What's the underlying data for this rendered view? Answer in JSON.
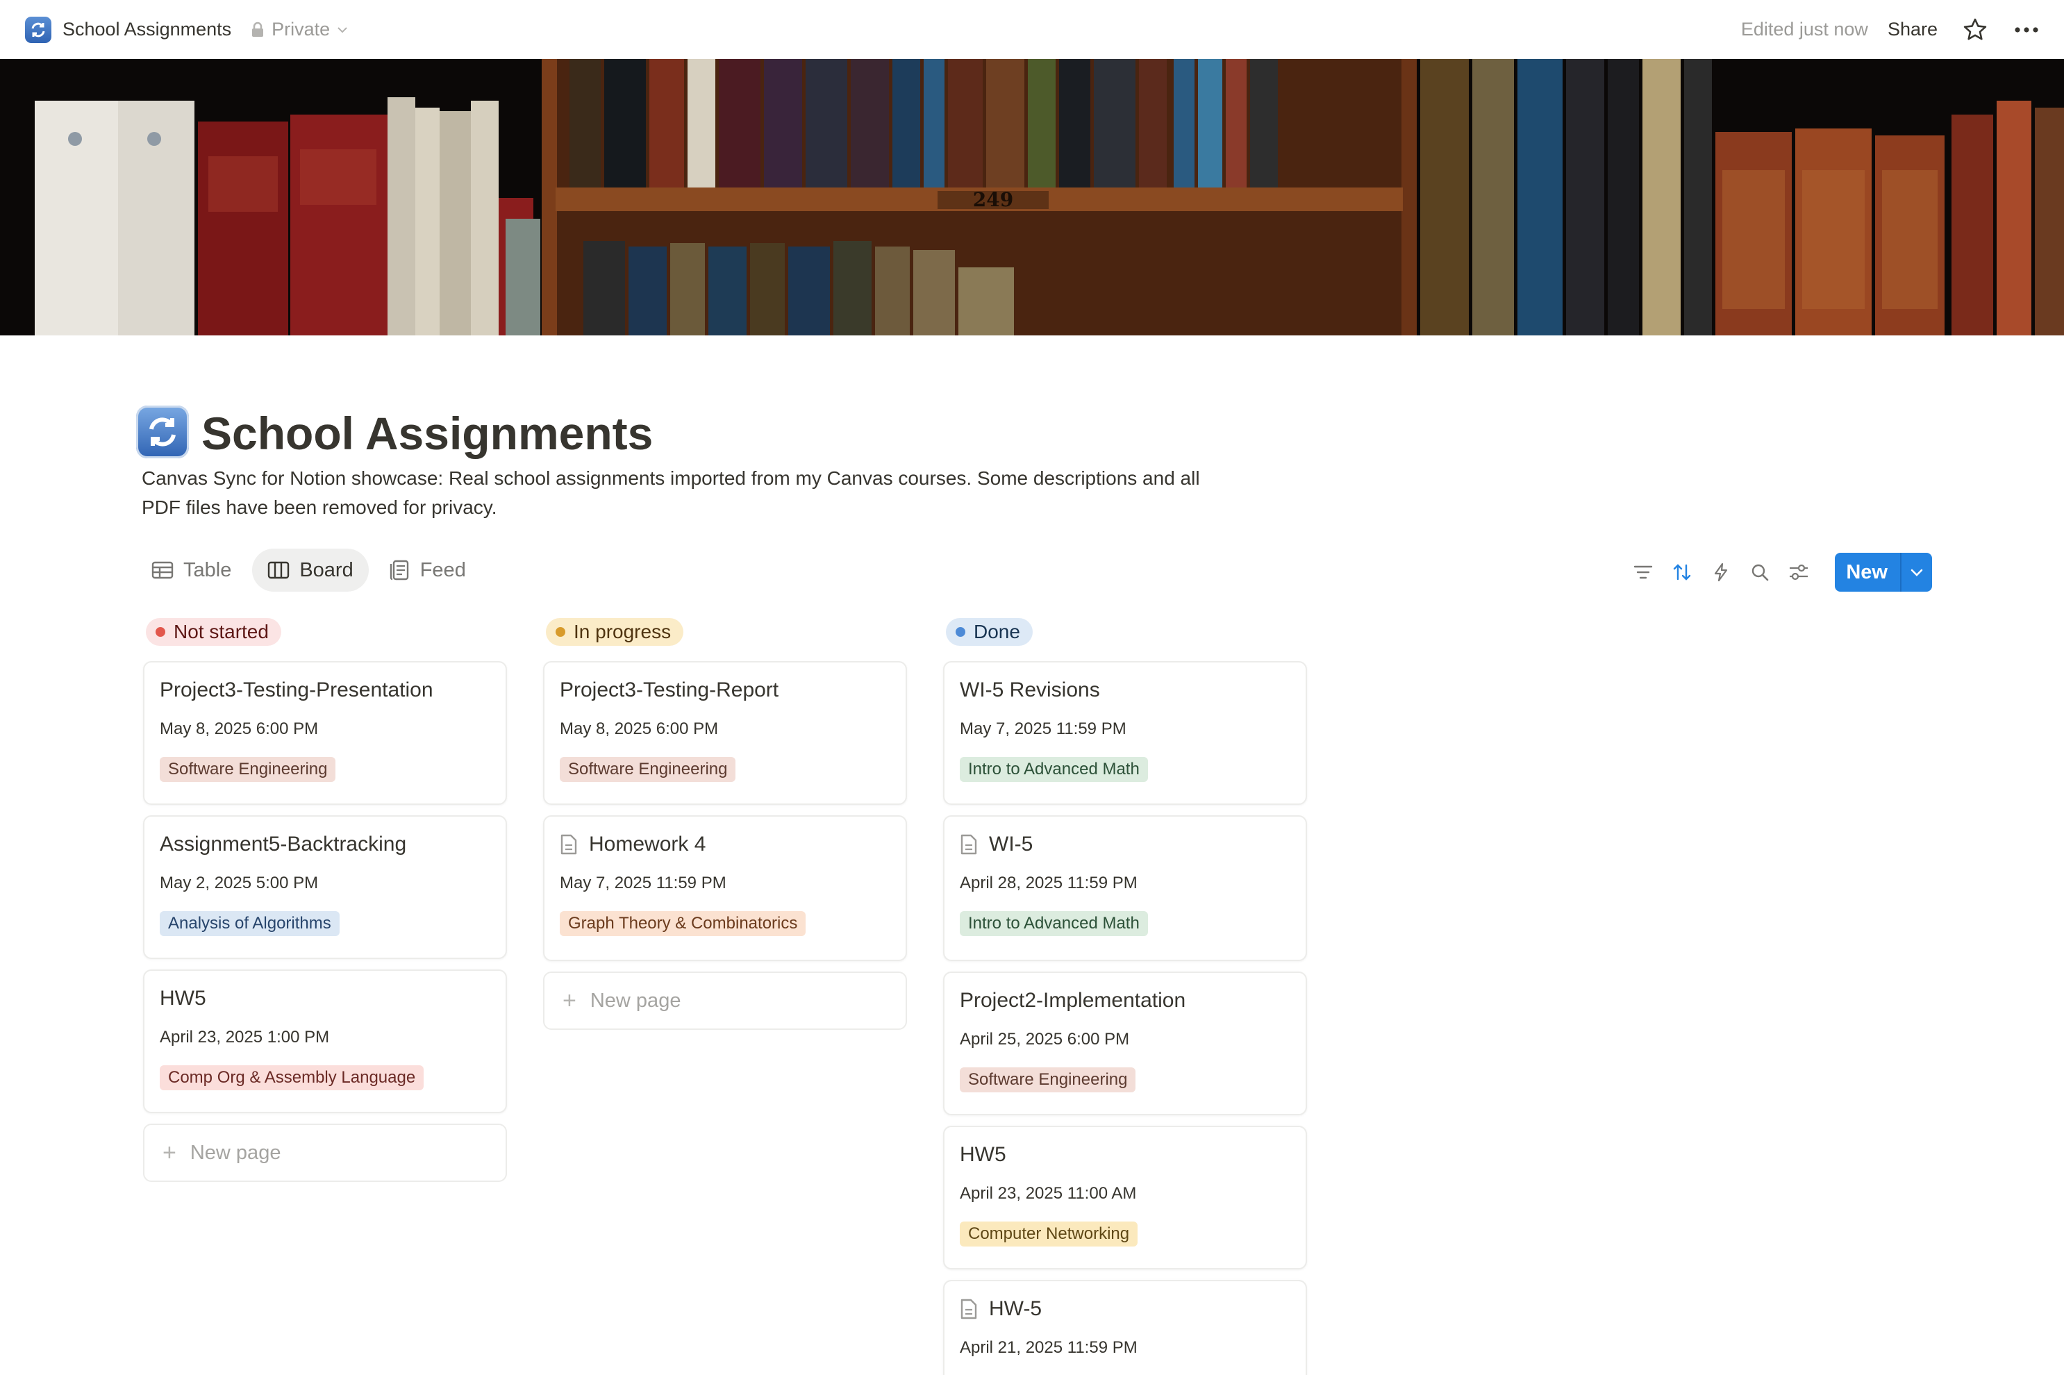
{
  "topbar": {
    "title": "School Assignments",
    "privacy": "Private",
    "edited": "Edited just now",
    "share": "Share"
  },
  "cover": {
    "shelf_number": "249"
  },
  "page": {
    "title": "School Assignments",
    "description": "Canvas Sync for Notion showcase: Real school assignments imported from my Canvas courses. Some descriptions and all PDF files have been removed for privacy."
  },
  "views": [
    "Table",
    "Board",
    "Feed"
  ],
  "toolbar": {
    "new_label": "New"
  },
  "colors": {
    "accent": "#2383e2",
    "not_started_bg": "#fbe4e4",
    "not_started_dot": "#e2574c",
    "in_progress_bg": "#fbecc8",
    "in_progress_dot": "#d89b2b",
    "done_bg": "#dde9f6",
    "done_dot": "#4d8ad6"
  },
  "board": {
    "new_page_label": "New page",
    "columns": [
      {
        "status": "Not started",
        "cards": [
          {
            "title": "Project3-Testing-Presentation",
            "date": "May 8, 2025 6:00 PM",
            "course": "Software Engineering"
          },
          {
            "title": "Assignment5-Backtracking",
            "date": "May 2, 2025 5:00 PM",
            "course": "Analysis of Algorithms"
          },
          {
            "title": "HW5",
            "date": "April 23, 2025 1:00 PM",
            "course": "Comp Org & Assembly Language"
          }
        ]
      },
      {
        "status": "In progress",
        "cards": [
          {
            "title": "Project3-Testing-Report",
            "date": "May 8, 2025 6:00 PM",
            "course": "Software Engineering"
          },
          {
            "title": "Homework 4",
            "date": "May 7, 2025 11:59 PM",
            "course": "Graph Theory & Combinatorics"
          }
        ]
      },
      {
        "status": "Done",
        "cards": [
          {
            "title": "WI-5 Revisions",
            "date": "May 7, 2025 11:59 PM",
            "course": "Intro to Advanced Math"
          },
          {
            "title": "WI-5",
            "date": "April 28, 2025 11:59 PM",
            "course": "Intro to Advanced Math"
          },
          {
            "title": "Project2-Implementation",
            "date": "April 25, 2025 6:00 PM",
            "course": "Software Engineering"
          },
          {
            "title": "HW5",
            "date": "April 23, 2025 11:00 AM",
            "course": "Computer Networking"
          },
          {
            "title": "HW-5",
            "date": "April 21, 2025 11:59 PM",
            "course": ""
          }
        ]
      }
    ]
  }
}
